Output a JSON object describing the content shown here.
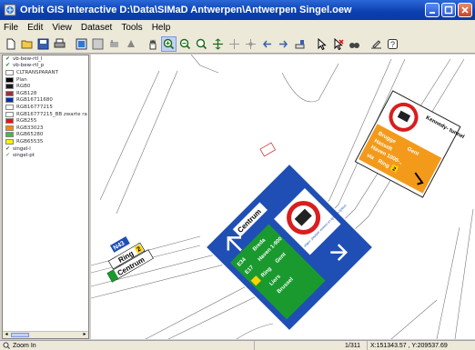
{
  "window": {
    "title": "Orbit GIS Interactive D:\\Data\\SIMaD Antwerpen\\Antwerpen Singel.oew"
  },
  "menu": [
    "File",
    "Edit",
    "View",
    "Dataset",
    "Tools",
    "Help"
  ],
  "toolbar": {
    "icons": [
      "new-icon",
      "open-icon",
      "save-icon",
      "print-icon",
      "map-icon",
      "grid-icon",
      "select-icon",
      "move-icon",
      "pan-hand-icon",
      "zoom-in-icon",
      "zoom-out-icon",
      "zoom-window-icon",
      "zoom-extent-icon",
      "pan-icon",
      "move-layer-icon",
      "back-icon",
      "forward-icon",
      "measure-icon",
      "pointer-icon",
      "delete-icon",
      "binoculars-icon",
      "draw-icon",
      "help-icon"
    ]
  },
  "legend": {
    "rows": [
      {
        "type": "layer",
        "label": "vb-bew-rtl_l",
        "checked": true
      },
      {
        "type": "layer",
        "label": "vb-bew-rtl_p",
        "checked": true
      },
      {
        "type": "class",
        "label": "CLTRANSPARANT",
        "color": "#ffffff"
      },
      {
        "type": "class",
        "label": "Plan",
        "color": "#000000"
      },
      {
        "type": "class",
        "label": "RGB0",
        "color": "#1a1a1a"
      },
      {
        "type": "class",
        "label": "RGB128",
        "color": "#993333"
      },
      {
        "type": "class",
        "label": "RGB16711680",
        "color": "#0033aa"
      },
      {
        "type": "class",
        "label": "RGB16777215",
        "color": "#ffffff"
      },
      {
        "type": "class",
        "label": "RGB16777215_BB zwarte ra",
        "color": "#ffffff"
      },
      {
        "type": "class",
        "label": "RGB255",
        "color": "#ee1111"
      },
      {
        "type": "class",
        "label": "RGB33023",
        "color": "#ff8800"
      },
      {
        "type": "class",
        "label": "RGB65280",
        "color": "#44bb44"
      },
      {
        "type": "class",
        "label": "RGB65535",
        "color": "#ffee00"
      },
      {
        "type": "layer",
        "label": "singel-l",
        "checked": true
      },
      {
        "type": "layer",
        "label": "singel-pt",
        "checked": false
      }
    ]
  },
  "map": {
    "sign_top_right": {
      "lines": [
        "Brugge",
        "Gent",
        "Hasselt",
        "Haven 1000-..",
        "via",
        "Ring",
        "2"
      ],
      "side_label": "Kennedy-\ntunnel"
    },
    "sign_center": {
      "left_top": "Centrum",
      "route_a": "E34",
      "route_b": "E17",
      "dest_a": "Breda",
      "dest_b": "Haven 1-900",
      "dest_c": "Ring",
      "dest_d": "Gent",
      "dest_e": "Liers",
      "dest_f": "Brussel",
      "right_caption": "uitgez. plaatsel\nverkeer en lijn A\nen lijnbus"
    },
    "sign_left": {
      "route": "N43",
      "line1": "Ring",
      "line1_badge": "2",
      "line2": "Centrum"
    }
  },
  "status": {
    "left": "Zoom In",
    "scale": "1/311",
    "coords": "X:151343.57 , Y:209537.69"
  },
  "colors": {
    "sign_blue": "#1f4fb5",
    "sign_green": "#1a9a2e",
    "sign_orange": "#f39a1b",
    "sign_red": "#d81e1e"
  }
}
